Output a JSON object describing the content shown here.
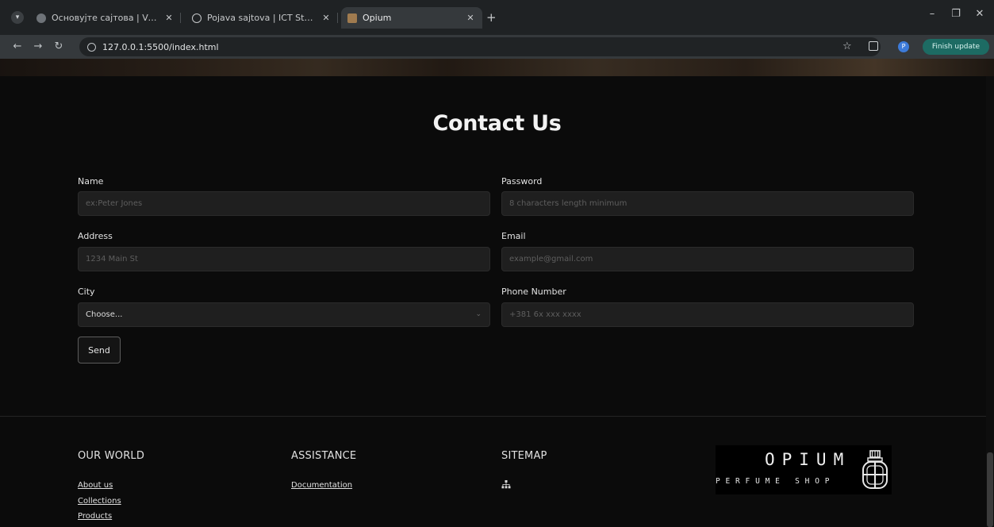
{
  "browser": {
    "tabs": [
      {
        "title": "Основујте сајтова | Visoka ICT",
        "favicon": "generic"
      },
      {
        "title": "Pojava sajtova | ICT Studentski",
        "favicon": "globe"
      },
      {
        "title": "Opium",
        "favicon": "opium",
        "active": true
      }
    ],
    "url": "127.0.0.1:5500/index.html",
    "profile_initial": "P",
    "update_label": "Finish update"
  },
  "contact": {
    "title": "Contact Us",
    "fields": {
      "name": {
        "label": "Name",
        "placeholder": "ex:Peter Jones"
      },
      "password": {
        "label": "Password",
        "placeholder": "8 characters length minimum"
      },
      "address": {
        "label": "Address",
        "placeholder": "1234 Main St"
      },
      "email": {
        "label": "Email",
        "placeholder": "example@gmail.com"
      },
      "city": {
        "label": "City",
        "selected": "Choose..."
      },
      "phone": {
        "label": "Phone Number",
        "placeholder": "+381 6x xxx xxxx"
      }
    },
    "send_label": "Send"
  },
  "footer": {
    "our_world": {
      "heading": "OUR WORLD",
      "links": [
        "About us",
        "Collections",
        "Products"
      ]
    },
    "assistance": {
      "heading": "ASSISTANCE",
      "links": [
        "Documentation"
      ]
    },
    "sitemap": {
      "heading": "SITEMAP",
      "icon": "sitemap-icon"
    },
    "logo": {
      "word": "OPIUM",
      "sub": "PERFUME SHOP"
    }
  },
  "colors": {
    "page_bg": "#0b0b0b",
    "input_bg": "#1f1f1f",
    "update_button": "#1d6b63"
  }
}
